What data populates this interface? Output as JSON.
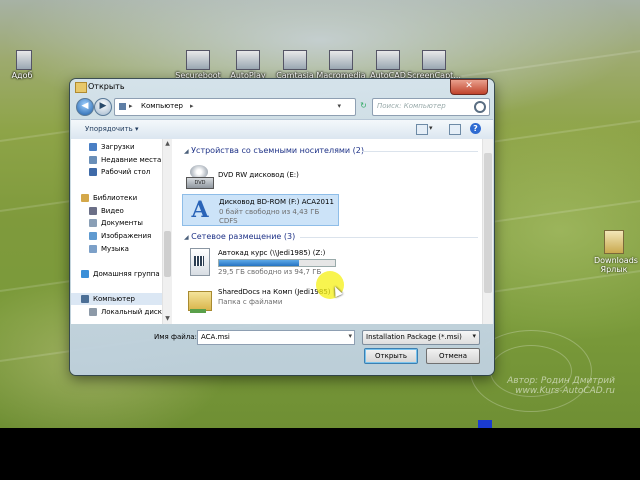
{
  "desktop": {
    "top_icons": [
      "Secureboot",
      "AutoPlay",
      "Camtasia",
      "Macromedia",
      "AutoCAD",
      "ScreenCapt..."
    ],
    "left_icon": "Адоб",
    "right_icon_line1": "Downloads",
    "right_icon_line2": "Ярлык",
    "watermark_line1": "Автор: Родин Дмитрий",
    "watermark_line2": "www.Kurs-AutoCAD.ru"
  },
  "dialog": {
    "title": "Открыть",
    "close_glyph": "✕",
    "address": {
      "crumb": "Компьютер",
      "arrow": "▸",
      "dropdown_glyph": "▾"
    },
    "search_placeholder": "Поиск: Компьютер",
    "toolbar": {
      "organize_label": "Упорядочить ▾",
      "help_glyph": "?"
    },
    "nav": [
      {
        "label": "Загрузки",
        "indent": 1,
        "color": "#4a7fc4"
      },
      {
        "label": "Недавние места",
        "indent": 1,
        "color": "#6a8fb8"
      },
      {
        "label": "Рабочий стол",
        "indent": 1,
        "color": "#3f6aa8"
      },
      {
        "label": "",
        "indent": 0,
        "color": ""
      },
      {
        "label": "Библиотеки",
        "indent": 0,
        "color": "#d4a84a"
      },
      {
        "label": "Видео",
        "indent": 1,
        "color": "#6b6f87"
      },
      {
        "label": "Документы",
        "indent": 1,
        "color": "#8a9fb6"
      },
      {
        "label": "Изображения",
        "indent": 1,
        "color": "#5f9ad0"
      },
      {
        "label": "Музыка",
        "indent": 1,
        "color": "#7ca0c8"
      },
      {
        "label": "",
        "indent": 0,
        "color": ""
      },
      {
        "label": "Домашняя группа",
        "indent": 0,
        "color": "#3b8fd8"
      },
      {
        "label": "",
        "indent": 0,
        "color": ""
      },
      {
        "label": "Компьютер",
        "indent": 0,
        "color": "#4c6f96",
        "selected": true
      },
      {
        "label": "Локальный диск",
        "indent": 1,
        "color": "#8d9aa8"
      }
    ],
    "groups": {
      "removable": "Устройства со съемными носителями (2)",
      "network": "Сетевое размещение (3)"
    },
    "items": {
      "dvd_rw": {
        "name": "DVD RW дисковод (E:)"
      },
      "bd_rom": {
        "name": "Дисковод BD-ROM (F:) ACA2011",
        "sub": "0 байт свободно из 4,43 ГБ",
        "sub2": "CDFS"
      },
      "net_drive": {
        "name": "Автокад курс (\\\\Jedi1985) (Z:)",
        "sub": "29,5 ГБ свободно из 94,7 ГБ",
        "fill": 0.69
      },
      "shared": {
        "name": "SharedDocs на Комп (Jedi1985)",
        "sub": "Папка с файлами"
      }
    },
    "filename_label": "Имя файла:",
    "filename_value": "ACA.msi",
    "filetype_value": "Installation Package (*.msi)",
    "open_button": "Открыть",
    "cancel_button": "Отмена"
  }
}
